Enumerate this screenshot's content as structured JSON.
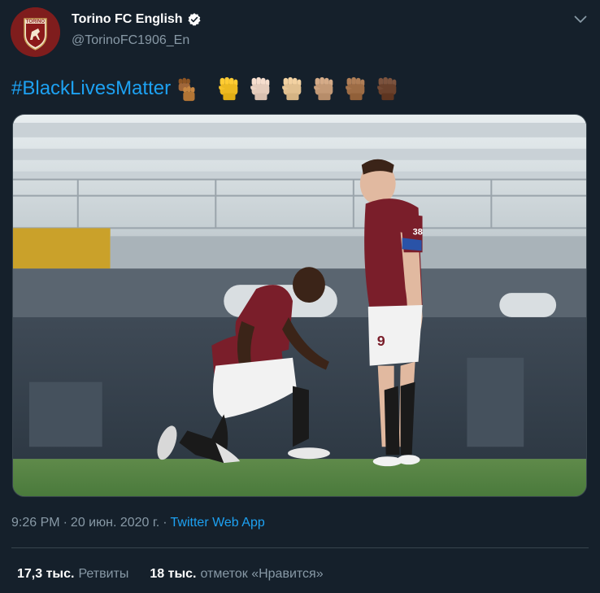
{
  "tweet": {
    "display_name": "Torino FC English",
    "handle": "@TorinoFC1906_En",
    "hashtag": "#BlackLivesMatter",
    "avatar_logo_text": "TORINO",
    "emojis": [
      {
        "icon": "raised-fist-emoji",
        "tone": "#8d5524"
      },
      {
        "icon": "raised-fist-emoji",
        "tone": "#ffcc33"
      },
      {
        "icon": "raised-fist-emoji",
        "tone": "#f7dece"
      },
      {
        "icon": "raised-fist-emoji",
        "tone": "#f3d2a2"
      },
      {
        "icon": "raised-fist-emoji",
        "tone": "#d5ab88"
      },
      {
        "icon": "raised-fist-emoji",
        "tone": "#af7e57"
      },
      {
        "icon": "raised-fist-emoji",
        "tone": "#7c533e"
      }
    ],
    "time": "9:26 PM",
    "separator": "·",
    "date": "20 июн. 2020 г.",
    "source": "Twitter Web App",
    "retweets_count": "17,3 тыс.",
    "retweets_label": "Ретвиты",
    "likes_count": "18 тыс.",
    "likes_label": "отметок «Нравится»",
    "player_numbers": [
      "38",
      "9"
    ]
  },
  "colors": {
    "background": "#15202b",
    "link": "#1da1f2",
    "secondary_text": "#8899a6",
    "border": "#38444d",
    "brand": "#8b1a1a"
  }
}
